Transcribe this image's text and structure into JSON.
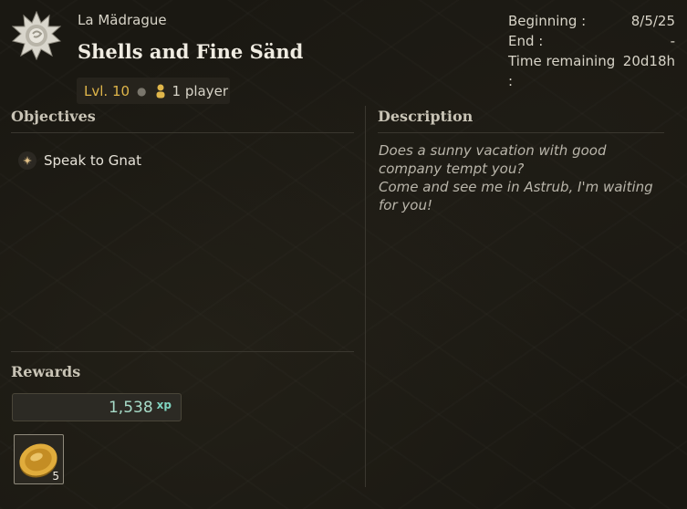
{
  "quest": {
    "area": "La Mädrague",
    "title": "Shells and Fine Sänd",
    "level": "Lvl. 10",
    "players": "1 player"
  },
  "dates": {
    "beginning_label": "Beginning :",
    "beginning_value": "8/5/25",
    "end_label": "End :",
    "end_value": "-",
    "remaining_label": "Time remaining :",
    "remaining_value": "20d18h"
  },
  "objectives": {
    "title": "Objectives",
    "items": [
      {
        "label": "Speak to Gnat"
      }
    ]
  },
  "description": {
    "title": "Description",
    "lines": [
      "Does a sunny vacation with good",
      "company tempt you?",
      "Come and see me in Astrub, I'm waiting",
      "for you!"
    ]
  },
  "rewards": {
    "title": "Rewards",
    "xp_value": "1,538",
    "xp_unit": "xp",
    "items": [
      {
        "icon": "gold-coin-icon",
        "quantity": "5"
      }
    ]
  },
  "colors": {
    "level": "#e0b64a",
    "xp": "#a7dbc8",
    "background": "#1a1812"
  }
}
